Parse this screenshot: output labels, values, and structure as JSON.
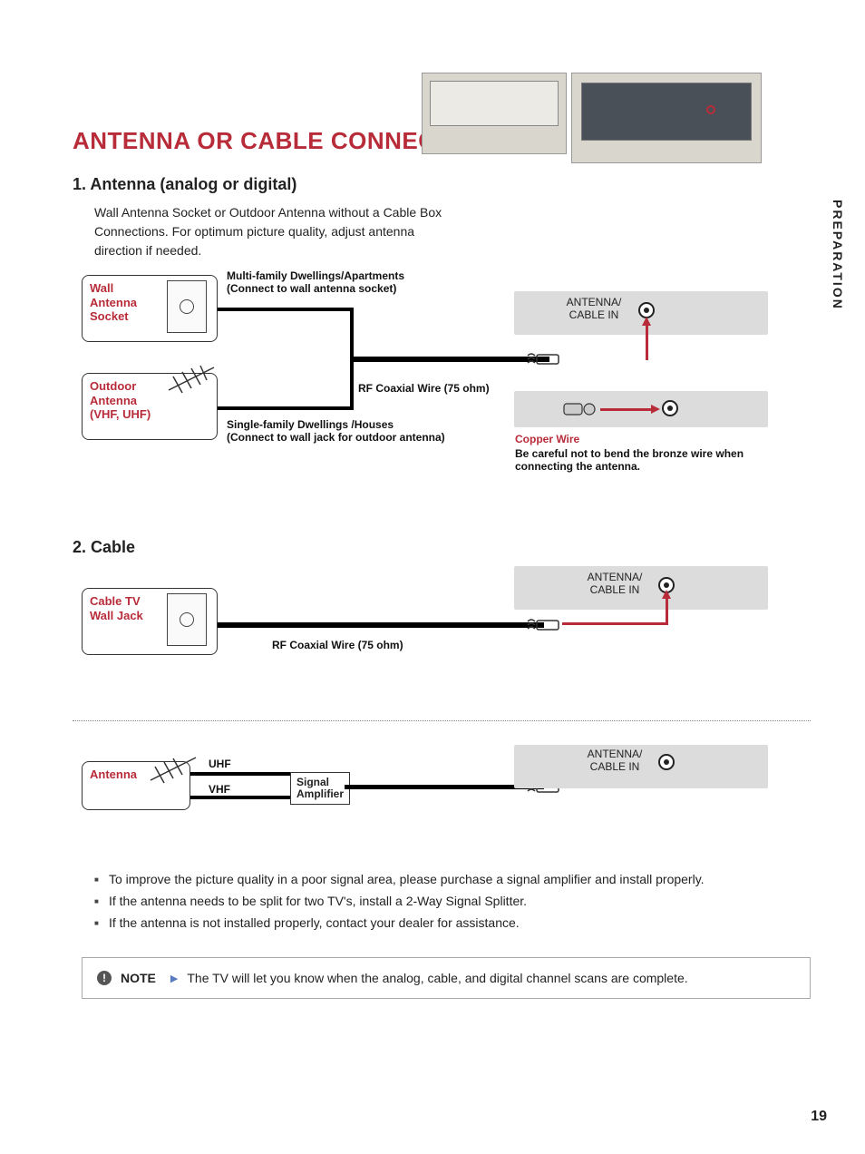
{
  "sideTab": "PREPARATION",
  "pageNumber": "19",
  "title": "ANTENNA OR CABLE CONNECTION",
  "section1": {
    "heading": "1. Antenna (analog or digital)",
    "description": "Wall Antenna Socket or Outdoor Antenna without a Cable Box Connections. For optimum picture quality, adjust antenna direction if needed.",
    "wallSocket": "Wall\nAntenna\nSocket",
    "outdoorAntenna": "Outdoor\nAntenna\n(VHF, UHF)",
    "multiFamily": "Multi-family Dwellings/Apartments\n(Connect to wall antenna socket)",
    "singleFamily": "Single-family Dwellings /Houses\n(Connect to wall jack for outdoor antenna)",
    "rfWire": "RF Coaxial Wire (75 ohm)",
    "antennaCableIn": "ANTENNA/\nCABLE IN",
    "copperWire": "Copper Wire",
    "copperWarning": "Be careful not to bend the bronze wire when connecting the antenna."
  },
  "section2": {
    "heading": "2. Cable",
    "cableJack": "Cable TV\nWall Jack",
    "rfWire": "RF Coaxial Wire (75 ohm)",
    "antennaCableIn": "ANTENNA/\nCABLE IN"
  },
  "section3": {
    "antenna": "Antenna",
    "uhf": "UHF",
    "vhf": "VHF",
    "signalAmp": "Signal\nAmplifier",
    "antennaCableIn": "ANTENNA/\nCABLE IN"
  },
  "bullets": [
    "To improve the picture quality in a poor signal area, please purchase a signal amplifier and install properly.",
    "If the antenna needs to be split for two TV's, install a 2-Way Signal Splitter.",
    "If the antenna is not installed properly, contact your dealer for assistance."
  ],
  "note": {
    "label": "NOTE",
    "text": "The TV will let you know when the analog, cable, and digital channel scans are complete."
  }
}
